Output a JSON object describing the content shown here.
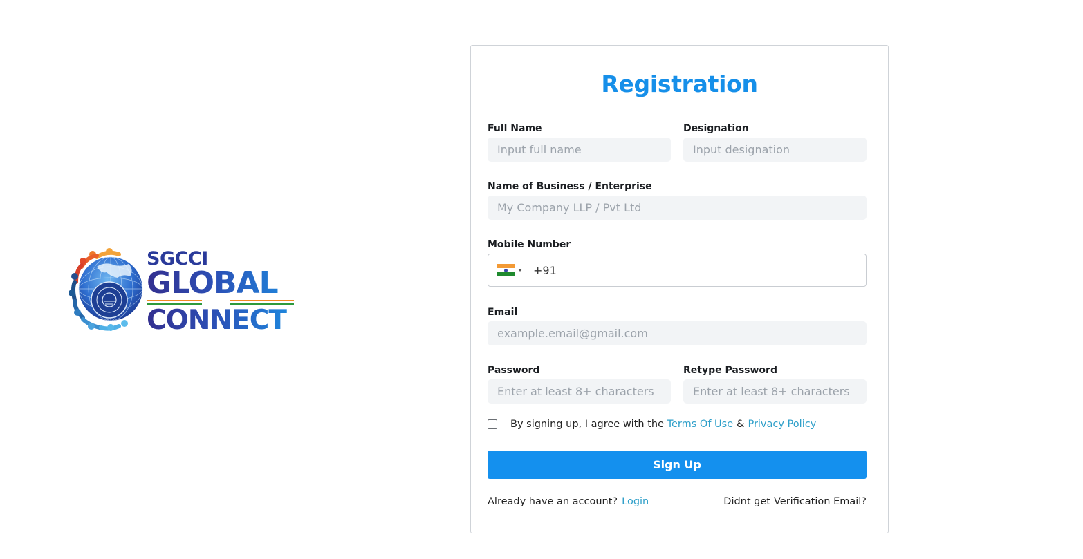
{
  "logo": {
    "line1": "SGCCI",
    "line2": "GLOBAL",
    "line3": "CONNECT",
    "stripe_colors": {
      "saffron": "#f08a24",
      "white": "#ffffff",
      "green": "#2e9a3c"
    }
  },
  "form": {
    "title": "Registration",
    "full_name": {
      "label": "Full Name",
      "placeholder": "Input full name",
      "value": ""
    },
    "designation": {
      "label": "Designation",
      "placeholder": "Input designation",
      "value": ""
    },
    "business": {
      "label": "Name of Business / Enterprise",
      "placeholder": "My Company LLP / Pvt Ltd",
      "value": ""
    },
    "mobile": {
      "label": "Mobile Number",
      "country_icon": "india-flag-icon",
      "country_code": "+91",
      "value": "+91"
    },
    "email": {
      "label": "Email",
      "placeholder": "example.email@gmail.com",
      "value": ""
    },
    "password": {
      "label": "Password",
      "placeholder": "Enter at least 8+ characters",
      "value": ""
    },
    "retype_password": {
      "label": "Retype Password",
      "placeholder": "Enter at least 8+ characters",
      "value": ""
    },
    "agree": {
      "checked": false,
      "prefix": "By signing up, I agree with the",
      "terms_label": "Terms Of Use",
      "ampersand": "&",
      "privacy_label": "Privacy Policy"
    },
    "submit_label": "Sign Up",
    "footer": {
      "login_prompt": "Already have an account?",
      "login_label": "Login",
      "verify_prompt": "Didnt get",
      "verify_label": "Verification Email?"
    }
  },
  "colors": {
    "accent": "#168fe9",
    "button": "#1490ee",
    "link": "#2e9fc9",
    "input_bg": "#f2f4f6"
  }
}
